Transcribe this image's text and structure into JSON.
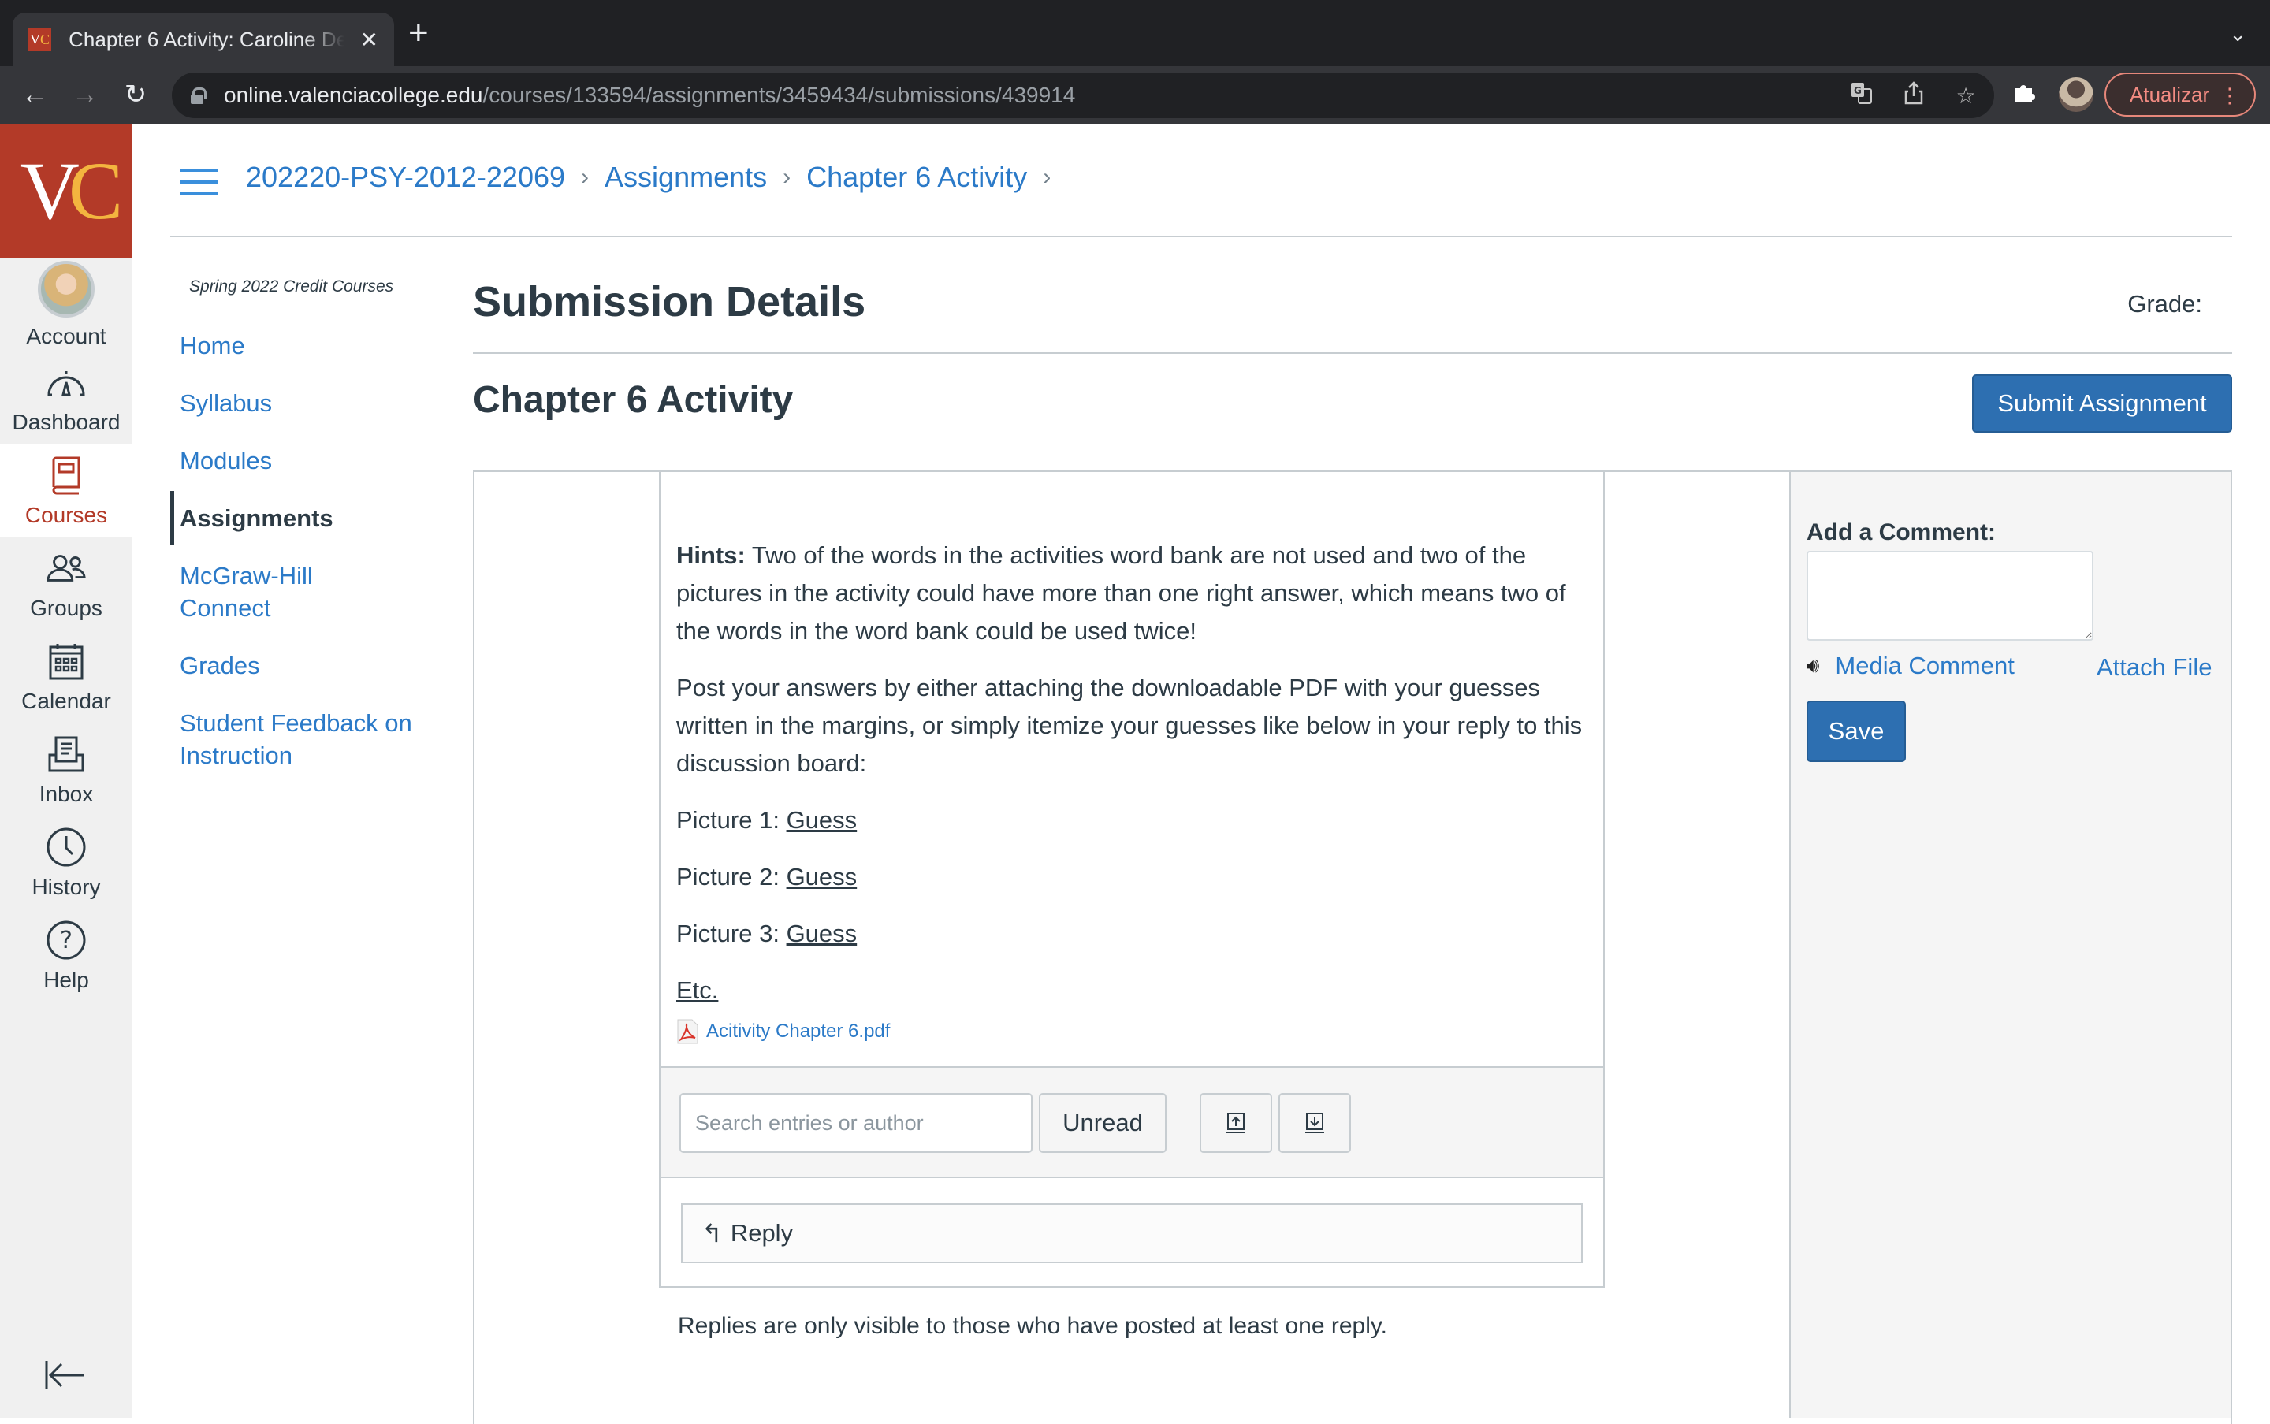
{
  "browser": {
    "tab_title": "Chapter 6 Activity: Caroline De",
    "favicon_text": "VC",
    "url_host": "online.valenciacollege.edu",
    "url_path": "/courses/133594/assignments/3459434/submissions/439914",
    "update_label": "Atualizar"
  },
  "global_nav": {
    "logo": "VC",
    "items": [
      {
        "label": "Account",
        "icon": "avatar"
      },
      {
        "label": "Dashboard",
        "icon": "dashboard-icon"
      },
      {
        "label": "Courses",
        "icon": "courses-icon",
        "active": true
      },
      {
        "label": "Groups",
        "icon": "groups-icon"
      },
      {
        "label": "Calendar",
        "icon": "calendar-icon"
      },
      {
        "label": "Inbox",
        "icon": "inbox-icon"
      },
      {
        "label": "History",
        "icon": "history-icon"
      },
      {
        "label": "Help",
        "icon": "help-icon"
      }
    ]
  },
  "breadcrumb": [
    "202220-PSY-2012-22069",
    "Assignments",
    "Chapter 6 Activity"
  ],
  "course_nav": {
    "term": "Spring 2022 Credit Courses",
    "items": [
      {
        "label": "Home"
      },
      {
        "label": "Syllabus"
      },
      {
        "label": "Modules"
      },
      {
        "label": "Assignments",
        "active": true
      },
      {
        "label": "McGraw-Hill Connect"
      },
      {
        "label": "Grades"
      },
      {
        "label": "Student Feedback on Instruction"
      }
    ]
  },
  "main": {
    "page_title": "Submission Details",
    "grade_label": "Grade:",
    "assignment_title": "Chapter 6 Activity",
    "submit_label": "Submit Assignment"
  },
  "discussion": {
    "hints_label": "Hints:",
    "hints_text": " Two of the words in the activities word bank are not used and two of the pictures in the activity could have more than one right answer, which means two of the words in the word bank could be used twice!",
    "instructions": "Post your answers by either attaching the downloadable PDF with your guesses written in the margins, or simply itemize your guesses like below in your reply to this discussion board:",
    "pictures": [
      {
        "label": "Picture 1: ",
        "guess": "Guess"
      },
      {
        "label": "Picture 2: ",
        "guess": "Guess"
      },
      {
        "label": "Picture 3: ",
        "guess": "Guess"
      }
    ],
    "etc": "Etc.",
    "attachment": "Acitivity Chapter 6.pdf",
    "search_placeholder": "Search entries or author",
    "search_value": "",
    "unread_label": "Unread",
    "reply_label": "Reply",
    "replies_note": "Replies are only visible to those who have posted at least one reply."
  },
  "comment": {
    "label": "Add a Comment:",
    "value": "",
    "media_comment": "Media Comment",
    "attach_file": "Attach File",
    "save_label": "Save"
  },
  "colors": {
    "brand": "#b33a28",
    "brand_accent": "#f3b53f",
    "link": "#2b7ac8",
    "primary_button": "#2d6fb1",
    "text": "#2d3b45"
  }
}
